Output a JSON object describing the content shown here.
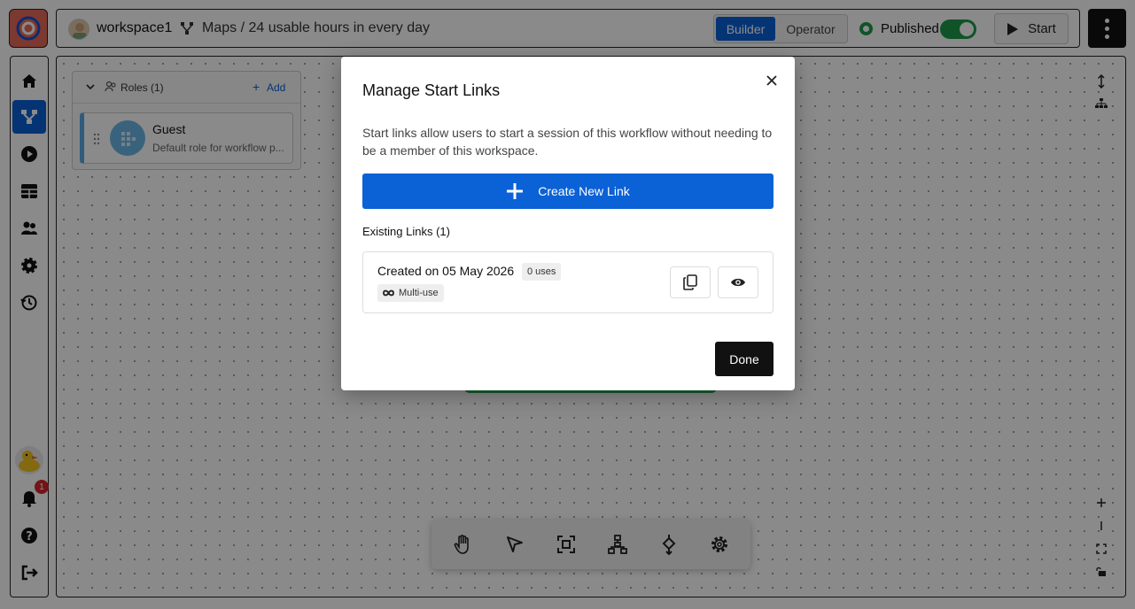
{
  "header": {
    "workspace_name": "workspace1",
    "breadcrumb": "Maps / 24 usable hours in every day",
    "mode_builder": "Builder",
    "mode_operator": "Operator",
    "status_label": "Published",
    "start_label": "Start"
  },
  "sidebar": {
    "notification_count": "1",
    "items": [
      "home-icon",
      "workflow-icon",
      "play-icon",
      "table-icon",
      "users-icon",
      "gear-icon",
      "history-icon"
    ]
  },
  "roles_panel": {
    "title": "Roles (1)",
    "add_label": "Add",
    "roles": [
      {
        "name": "Guest",
        "description": "Default role for workflow p..."
      }
    ]
  },
  "modal": {
    "title": "Manage Start Links",
    "description": "Start links allow users to start a session of this workflow without needing to be a member of this workspace.",
    "create_button": "Create New Link",
    "existing_label": "Existing Links (1)",
    "links": [
      {
        "created": "Created on 05 May 2026",
        "uses": "0 uses",
        "type": "Multi-use"
      }
    ],
    "done_button": "Done"
  },
  "colors": {
    "primary": "#0b61d6",
    "published": "#1f9a4a",
    "notification": "#d7262b"
  }
}
